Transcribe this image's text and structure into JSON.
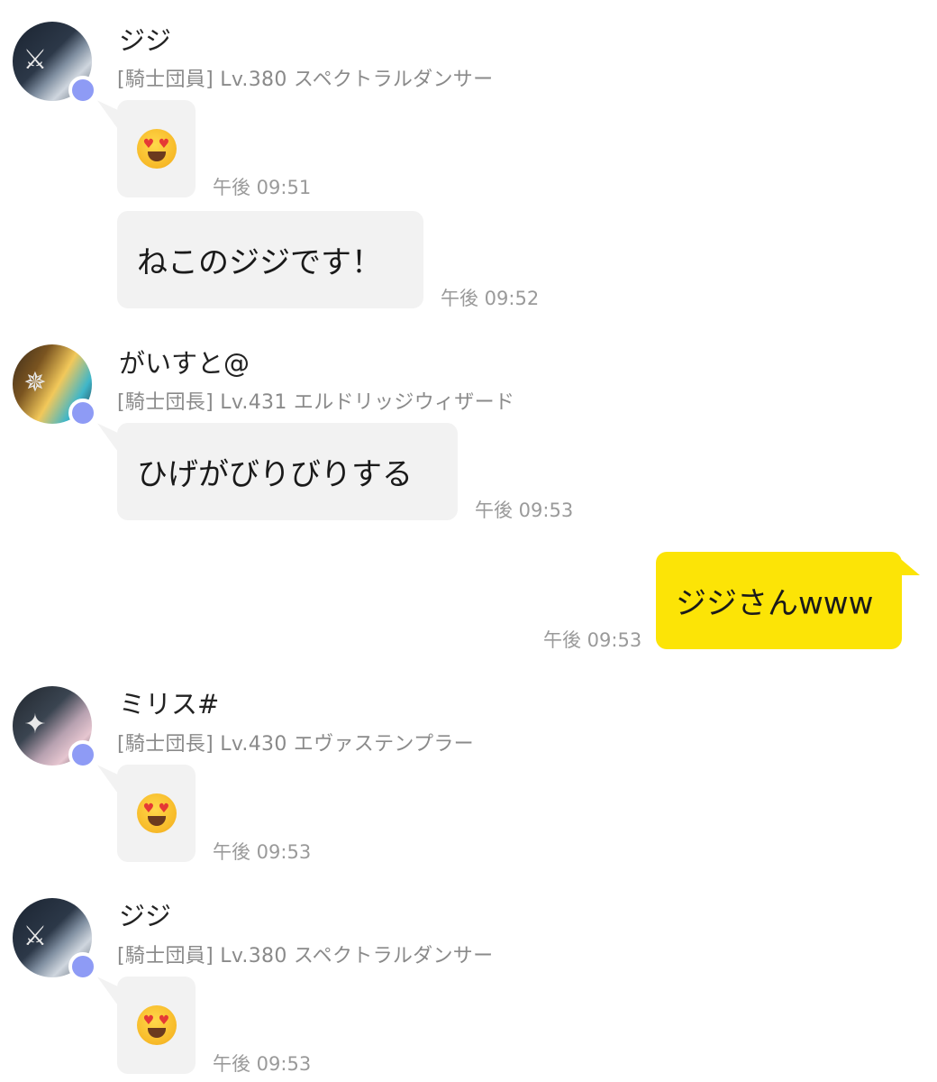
{
  "colors": {
    "bubble_other": "#f2f2f2",
    "bubble_mine": "#fce406",
    "status_dot": "#8e9bf5",
    "meta_text": "#8a8a8a"
  },
  "messages": [
    {
      "sender": "ジジ",
      "meta": "[騎士団員] Lv.380 スペクトラルダンサー",
      "avatar_icon": "swords-emblem-avatar",
      "bubbles": [
        {
          "type": "emoji",
          "emoji": "heart-eyes-emoji",
          "time": "午後 09:51"
        },
        {
          "type": "text",
          "text": "ねこのジジです！",
          "time": "午後 09:52"
        }
      ]
    },
    {
      "sender": "がいすと@",
      "meta": "[騎士団長] Lv.431 エルドリッジウィザード",
      "avatar_icon": "compass-emblem-avatar",
      "bubbles": [
        {
          "type": "text",
          "text": "ひげがびりびりする",
          "time": "午後 09:53"
        }
      ]
    },
    {
      "mine": true,
      "bubbles": [
        {
          "type": "text",
          "text": "ジジさんwww",
          "time": "午後 09:53"
        }
      ]
    },
    {
      "sender": "ミリス#",
      "meta": "[騎士団長] Lv.430 エヴァステンプラー",
      "avatar_icon": "star-emblem-avatar",
      "bubbles": [
        {
          "type": "emoji",
          "emoji": "heart-eyes-emoji",
          "time": "午後 09:53"
        }
      ]
    },
    {
      "sender": "ジジ",
      "meta": "[騎士団員] Lv.380 スペクトラルダンサー",
      "avatar_icon": "swords-emblem-avatar",
      "bubbles": [
        {
          "type": "emoji",
          "emoji": "heart-eyes-emoji",
          "time": "午後 09:53"
        }
      ]
    }
  ]
}
